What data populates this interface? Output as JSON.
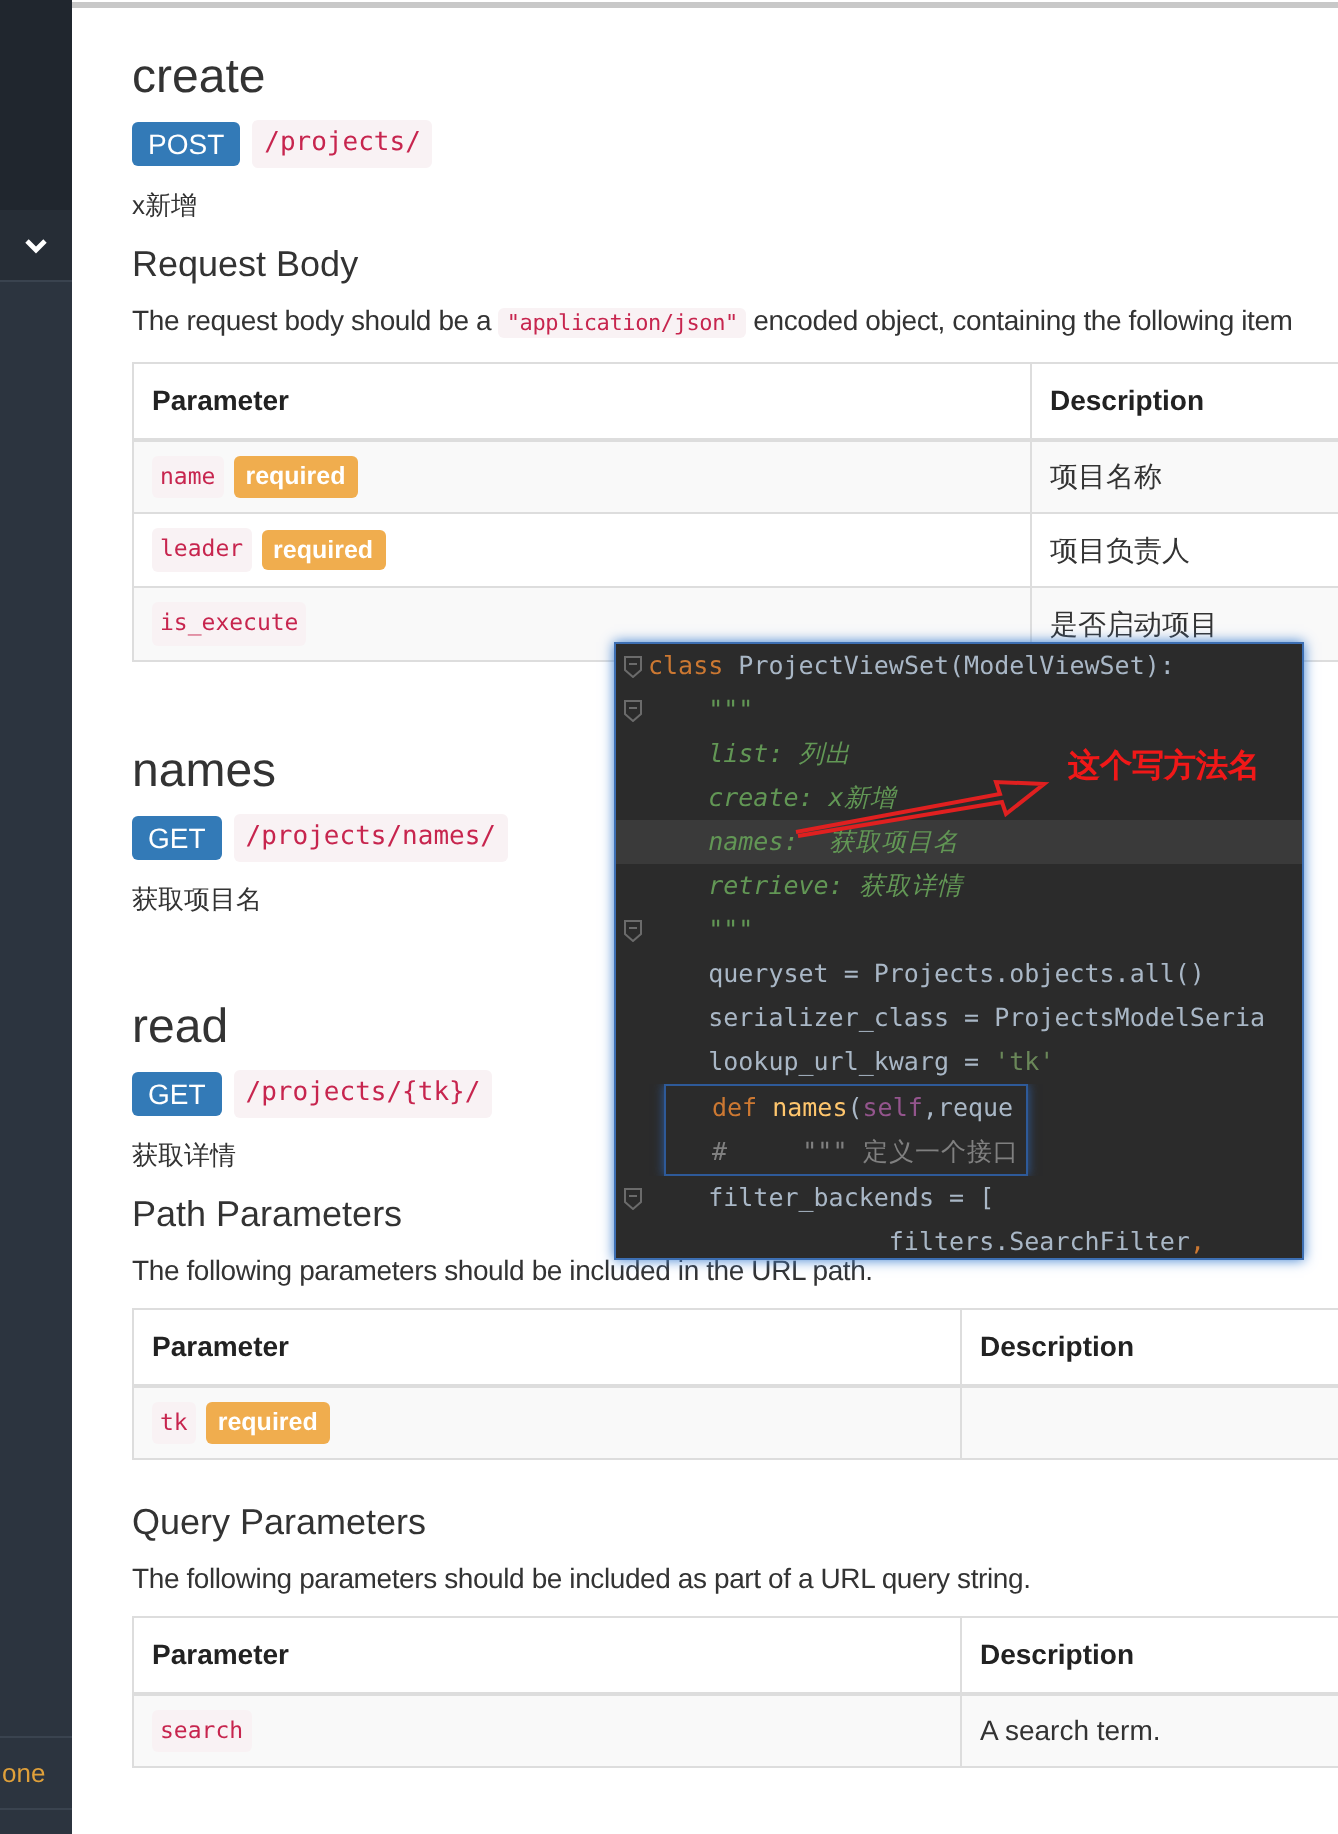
{
  "sidebar": {
    "bottom_item": "one"
  },
  "sections": [
    {
      "title": "create",
      "method": "POST",
      "path": "/projects/",
      "description": "x新增",
      "blocks": [
        {
          "heading": "Request Body",
          "intro_before": "The request body should be a",
          "intro_code": "\"application/json\"",
          "intro_after": "encoded object, containing the following item",
          "columns": [
            "Parameter",
            "Description"
          ],
          "rows": [
            {
              "param": "name",
              "required": true,
              "badge": "required",
              "description": "项目名称"
            },
            {
              "param": "leader",
              "required": true,
              "badge": "required",
              "description": "项目负责人"
            },
            {
              "param": "is_execute",
              "required": false,
              "description": "是否启动项目"
            }
          ]
        }
      ]
    },
    {
      "title": "names",
      "method": "GET",
      "path": "/projects/names/",
      "description": "获取项目名"
    },
    {
      "title": "read",
      "method": "GET",
      "path": "/projects/{tk}/",
      "description": "获取详情",
      "blocks": [
        {
          "heading": "Path Parameters",
          "intro_before": "The following parameters should be included in the URL path.",
          "columns": [
            "Parameter",
            "Description"
          ],
          "rows": [
            {
              "param": "tk",
              "required": true,
              "badge": "required"
            }
          ]
        },
        {
          "heading": "Query Parameters",
          "intro_before": "The following parameters should be included as part of a URL query string.",
          "columns": [
            "Parameter",
            "Description"
          ],
          "rows": [
            {
              "param": "search",
              "required": false,
              "description": "A search term."
            }
          ]
        }
      ]
    }
  ],
  "ide_popup": {
    "lines": [
      {
        "fold": true,
        "highlighted": false,
        "tokens": [
          {
            "kind": "keyword",
            "text": "class"
          },
          {
            "kind": "plain",
            "text": " ProjectViewSet(ModelViewSet):"
          }
        ]
      },
      {
        "fold": true,
        "highlighted": false,
        "tokens": [
          {
            "kind": "doc",
            "text": "    \"\"\""
          }
        ]
      },
      {
        "fold": false,
        "highlighted": false,
        "tokens": [
          {
            "kind": "doc",
            "text": "    list: 列出"
          }
        ]
      },
      {
        "fold": false,
        "highlighted": false,
        "tokens": [
          {
            "kind": "doc",
            "text": "    create: x新增"
          }
        ]
      },
      {
        "fold": false,
        "highlighted": true,
        "tokens": [
          {
            "kind": "doc",
            "text": "    names:  获取项目名"
          }
        ]
      },
      {
        "fold": false,
        "highlighted": false,
        "tokens": [
          {
            "kind": "doc",
            "text": "    retrieve: 获取详情"
          }
        ]
      },
      {
        "fold": true,
        "highlighted": false,
        "tokens": [
          {
            "kind": "doc",
            "text": "    \"\"\""
          }
        ]
      },
      {
        "fold": false,
        "highlighted": false,
        "tokens": [
          {
            "kind": "plain",
            "text": "    queryset = Projects.objects.all()"
          }
        ]
      },
      {
        "fold": false,
        "highlighted": false,
        "tokens": [
          {
            "kind": "plain",
            "text": "    serializer_class = ProjectsModelSeria"
          }
        ]
      },
      {
        "fold": false,
        "highlighted": false,
        "tokens": [
          {
            "kind": "plain",
            "text": "    lookup_url_kwarg = "
          },
          {
            "kind": "string",
            "text": "'tk'"
          }
        ]
      },
      {
        "fold": false,
        "highlighted": false,
        "framed": true,
        "tokens": [
          {
            "kind": "keyword",
            "text": "def "
          },
          {
            "kind": "function",
            "text": "names"
          },
          {
            "kind": "plain",
            "text": "("
          },
          {
            "kind": "self",
            "text": "self"
          },
          {
            "kind": "plain",
            "text": ",reque"
          }
        ]
      },
      {
        "fold": false,
        "highlighted": false,
        "framed": true,
        "tokens": [
          {
            "kind": "comment",
            "text": "#     \"\"\" 定义一个接口"
          }
        ]
      },
      {
        "fold": true,
        "highlighted": false,
        "tokens": [
          {
            "kind": "plain",
            "text": "    filter_backends = ["
          }
        ]
      },
      {
        "fold": false,
        "highlighted": false,
        "tokens": [
          {
            "kind": "plain",
            "text": "                filters.SearchFilter"
          },
          {
            "kind": "keyword",
            "text": ","
          }
        ]
      }
    ],
    "annotation": "这个写方法名"
  }
}
